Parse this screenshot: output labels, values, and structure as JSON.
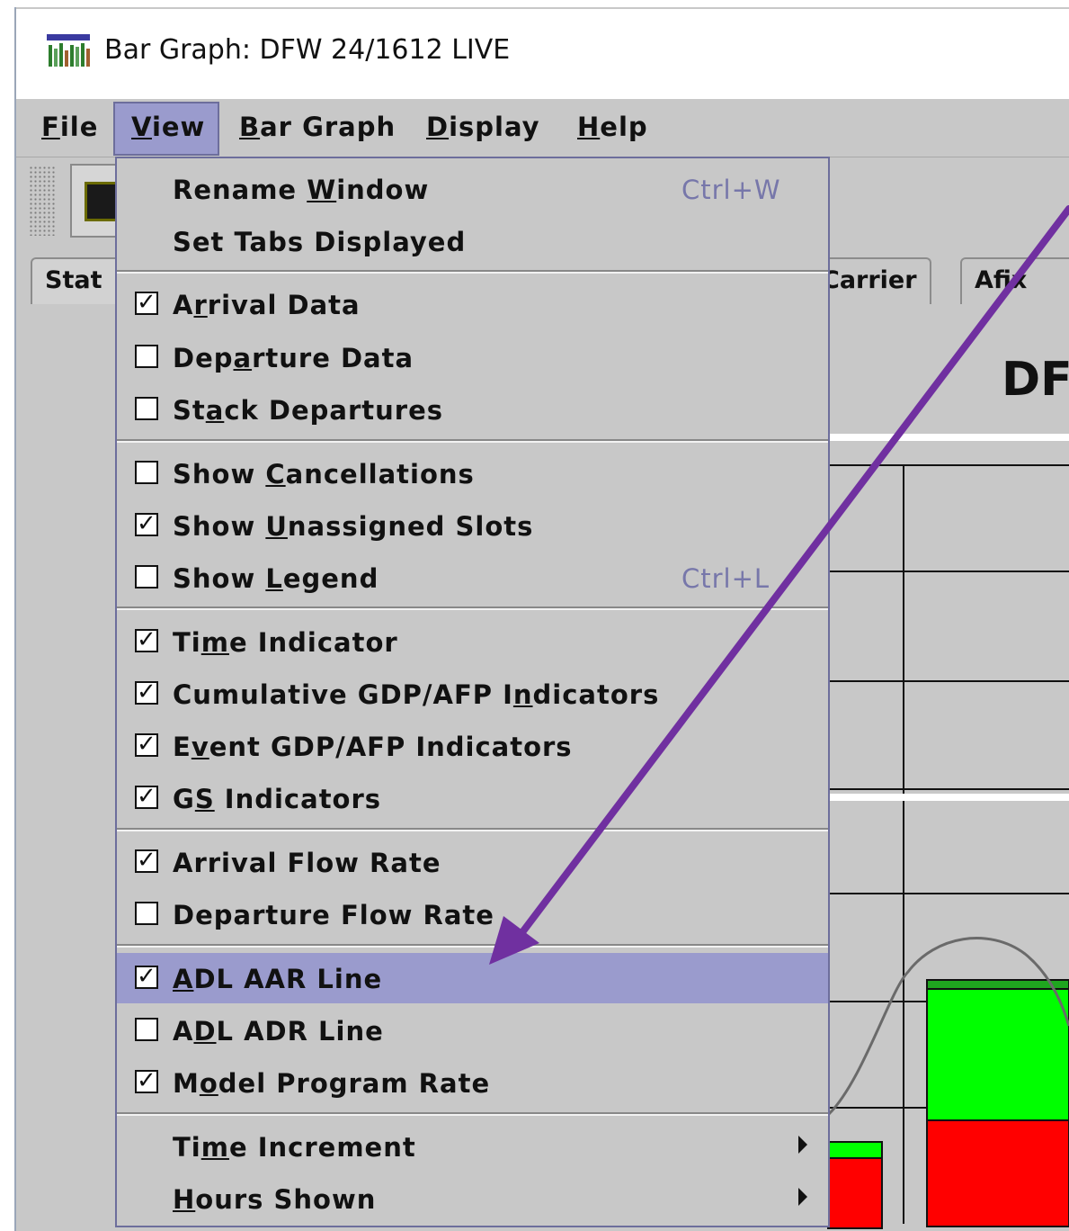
{
  "window": {
    "title": "Bar Graph: DFW 24/1612 LIVE"
  },
  "menubar": {
    "items": [
      {
        "pre": "",
        "u": "F",
        "post": "ile"
      },
      {
        "pre": "",
        "u": "V",
        "post": "iew"
      },
      {
        "pre": "",
        "u": "B",
        "post": "ar Graph"
      },
      {
        "pre": "",
        "u": "D",
        "post": "isplay"
      },
      {
        "pre": "",
        "u": "H",
        "post": "elp"
      }
    ],
    "active": "View"
  },
  "tabs": {
    "stat": "Stat",
    "carrier": "Carrier",
    "afix": "Afix"
  },
  "chart": {
    "title_fragment": "DF"
  },
  "view_menu": {
    "rename_window": {
      "pre": "Rename ",
      "u": "W",
      "post": "indow",
      "shortcut": "Ctrl+W"
    },
    "set_tabs": {
      "label": "Set Tabs Displayed"
    },
    "arrival_data": {
      "pre": "A",
      "u": "r",
      "post": "rival Data",
      "checked": true
    },
    "departure_data": {
      "pre": "Dep",
      "u": "a",
      "post": "rture Data",
      "checked": false
    },
    "stack_departures": {
      "pre": "St",
      "u": "a",
      "post": "ck Departures",
      "checked": false
    },
    "show_cancellations": {
      "pre": "Show ",
      "u": "C",
      "post": "ancellations",
      "checked": false
    },
    "show_unassigned": {
      "pre": "Show ",
      "u": "U",
      "post": "nassigned Slots",
      "checked": true
    },
    "show_legend": {
      "pre": "Show ",
      "u": "L",
      "post": "egend",
      "checked": false,
      "shortcut": "Ctrl+L"
    },
    "time_indicator": {
      "pre": "Ti",
      "u": "m",
      "post": "e Indicator",
      "checked": true
    },
    "cumulative": {
      "pre": "Cumulative GDP/AFP I",
      "u": "n",
      "post": "dicators",
      "checked": true
    },
    "event": {
      "pre": "E",
      "u": "v",
      "post": "ent GDP/AFP Indicators",
      "checked": true
    },
    "gs": {
      "pre": "G",
      "u": "S",
      "post": " Indicators",
      "checked": true
    },
    "arrival_flow": {
      "label": "Arrival Flow Rate",
      "checked": true
    },
    "departure_flow": {
      "label": "Departure Flow Rate",
      "checked": false
    },
    "adl_aar": {
      "pre": "",
      "u": "A",
      "post": "DL AAR Line",
      "checked": true,
      "highlighted": true
    },
    "adl_adr": {
      "pre": "A",
      "u": "D",
      "post": "L ADR Line",
      "checked": false
    },
    "model_program": {
      "pre": "M",
      "u": "o",
      "post": "del Program Rate",
      "checked": true
    },
    "time_increment": {
      "pre": "Ti",
      "u": "m",
      "post": "e Increment"
    },
    "hours_shown": {
      "pre": "",
      "u": "H",
      "post": "ours Shown"
    }
  },
  "check_glyph": "✓",
  "colors": {
    "menu_highlight": "#9a9bcd",
    "annotation_arrow": "#7030a0",
    "bar_green": "#00ff00",
    "bar_red": "#ff0000"
  }
}
